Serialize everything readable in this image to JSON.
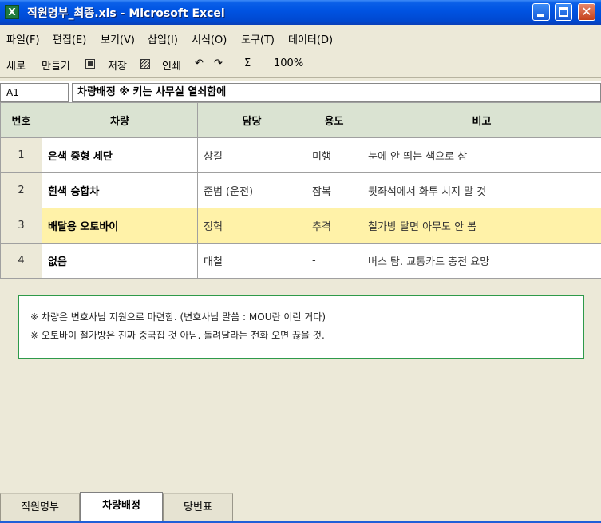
{
  "window": {
    "app_icon": "X",
    "title": "직원명부_최종.xls - Microsoft Excel",
    "min_label": "minimize",
    "max_label": "maximize",
    "close_label": "close",
    "accent": "#0054e3"
  },
  "menu": [
    "파일(F)",
    "편집(E)",
    "보기(V)",
    "삽입(I)",
    "서식(O)",
    "도구(T)",
    "데이터(D)"
  ],
  "toolbar": {
    "new": "새로",
    "make": "만들기",
    "save": "저장",
    "print": "인쇄",
    "undo": "↶",
    "redo": "↷",
    "sum": "Σ",
    "zoom": "100%"
  },
  "formula_bar": {
    "cell": "A1",
    "content": "차량배정 ※ 키는 사무실 열쇠함에"
  },
  "sheet": {
    "headers": [
      "번호",
      "차량",
      "담당",
      "용도",
      "비고"
    ],
    "rows": [
      {
        "num": "1",
        "vehicle": "은색 중형 세단",
        "owner": "상길",
        "use": "미행",
        "note": "눈에 안 띄는 색으로 삼"
      },
      {
        "num": "2",
        "vehicle": "흰색 승합차",
        "owner": "준범 (운전)",
        "use": "잠복",
        "note": "뒷좌석에서 화투 치지 말 것"
      },
      {
        "num": "3",
        "vehicle": "배달용 오토바이",
        "owner": "정혁",
        "use": "추격",
        "note": "철가방 달면 아무도 안 봄"
      },
      {
        "num": "4",
        "vehicle": "없음",
        "owner": "대철",
        "use": "-",
        "note": "버스 탐. 교통카드 충전 요망"
      }
    ],
    "highlight_color": "#fff2a8",
    "header_color": "#dae3d2"
  },
  "notes": [
    "※ 차량은 변호사님 지원으로 마련함. (변호사님 말씀 : MOU란 이런 거다)",
    "※ 오토바이 철가방은 진짜 중국집 것 아님. 돌려달라는 전화 오면 끊을 것."
  ],
  "tabs": [
    "직원명부",
    "차량배정",
    "당번표"
  ],
  "active_tab": "차량배정"
}
